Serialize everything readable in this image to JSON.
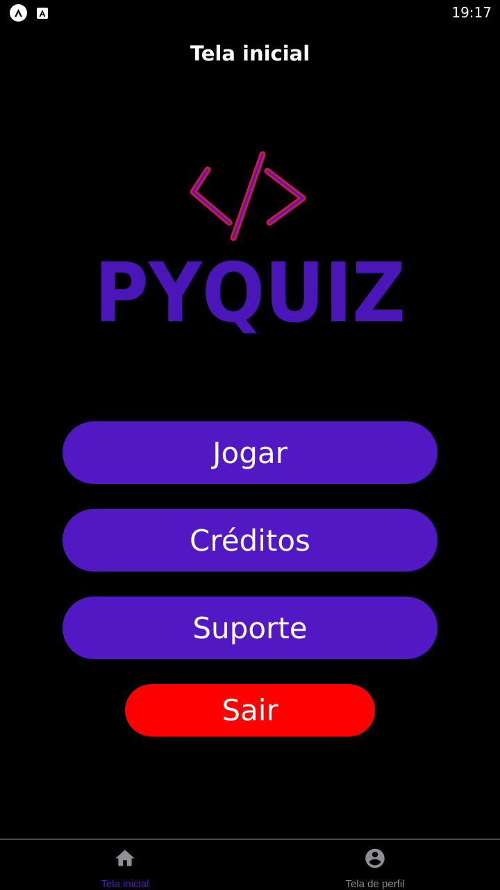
{
  "status_bar": {
    "time": "19:17",
    "icons": [
      "expo-icon",
      "font-icon"
    ]
  },
  "header": {
    "title": "Tela inicial"
  },
  "logo": {
    "text": "PYQUIZ",
    "icon": "code-brackets-icon",
    "text_color": "#4b16b8",
    "bracket_color": "#d01a3a"
  },
  "menu": {
    "play_label": "Jogar",
    "credits_label": "Créditos",
    "support_label": "Suporte",
    "exit_label": "Sair"
  },
  "colors": {
    "primary": "#5118c4",
    "danger": "#ff0000",
    "background": "#000000",
    "inactive": "#8e8e93"
  },
  "bottom_nav": {
    "items": [
      {
        "label": "Tela inicial",
        "icon": "home-icon",
        "active": true
      },
      {
        "label": "Tela de perfil",
        "icon": "account-circle-icon",
        "active": false
      }
    ]
  }
}
